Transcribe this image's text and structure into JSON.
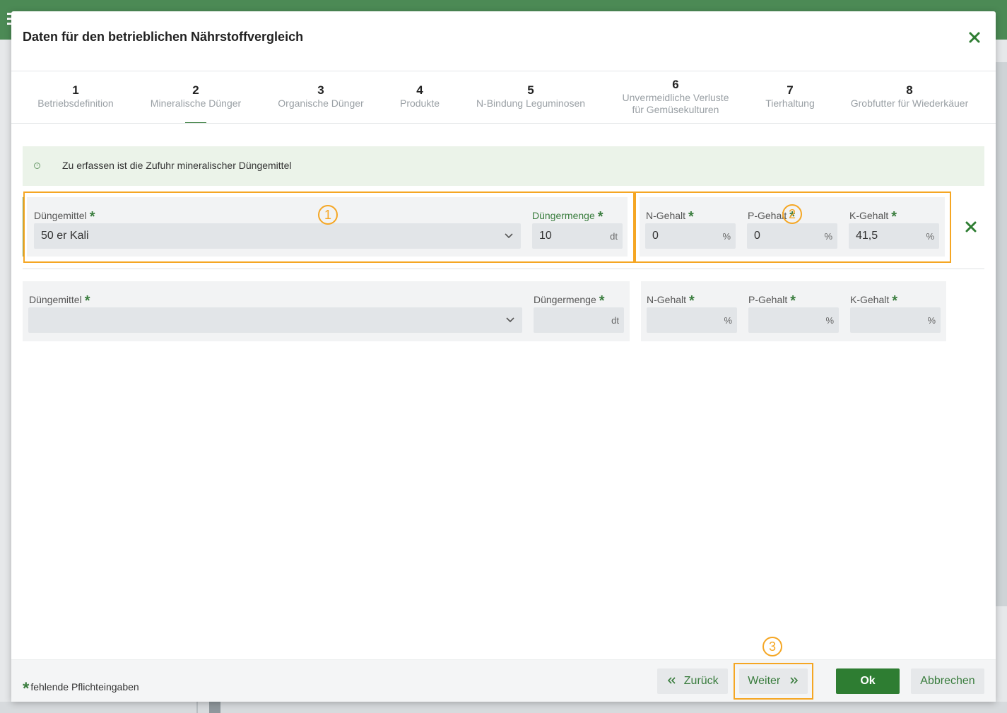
{
  "modal": {
    "title": "Daten für den betrieblichen Nährstoffvergleich"
  },
  "steps": [
    {
      "num": "1",
      "label": "Betriebsdefinition"
    },
    {
      "num": "2",
      "label": "Mineralische Dünger"
    },
    {
      "num": "3",
      "label": "Organische Dünger"
    },
    {
      "num": "4",
      "label": "Produkte"
    },
    {
      "num": "5",
      "label": "N-Bindung Leguminosen"
    },
    {
      "num": "6",
      "label_line1": "Unvermeidliche Verluste",
      "label_line2": "für Gemüsekulturen"
    },
    {
      "num": "7",
      "label": "Tierhaltung"
    },
    {
      "num": "8",
      "label": "Grobfutter für Wiederkäuer"
    }
  ],
  "info": {
    "icon": "info-icon",
    "text": "Zu erfassen ist die Zufuhr mineralischer Düngemittel"
  },
  "rows": [
    {
      "duengemittel_label": "Düngemittel",
      "duengemittel_value": "50 er Kali",
      "menge_label": "Düngermenge",
      "menge_value": "10",
      "menge_unit": "dt",
      "n_label": "N-Gehalt",
      "n_value": "0",
      "n_unit": "%",
      "p_label": "P-Gehalt",
      "p_value": "0",
      "p_unit": "%",
      "k_label": "K-Gehalt",
      "k_value": "41,5",
      "k_unit": "%"
    },
    {
      "duengemittel_label": "Düngemittel",
      "duengemittel_value": "",
      "menge_label": "Düngermenge",
      "menge_value": "",
      "menge_unit": "dt",
      "n_label": "N-Gehalt",
      "n_value": "",
      "n_unit": "%",
      "p_label": "P-Gehalt",
      "p_value": "",
      "p_unit": "%",
      "k_label": "K-Gehalt",
      "k_value": "",
      "k_unit": "%"
    }
  ],
  "required_marker": "*",
  "annotations": [
    "1",
    "2",
    "3"
  ],
  "footer": {
    "footnote": "fehlende Pflichteingaben",
    "back_label": "Zurück",
    "next_label": "Weiter",
    "ok_label": "Ok",
    "cancel_label": "Abbrechen"
  },
  "colors": {
    "brand_green": "#2e7d32",
    "highlight_orange": "#f5a623",
    "topbar": "#4c8a55"
  }
}
